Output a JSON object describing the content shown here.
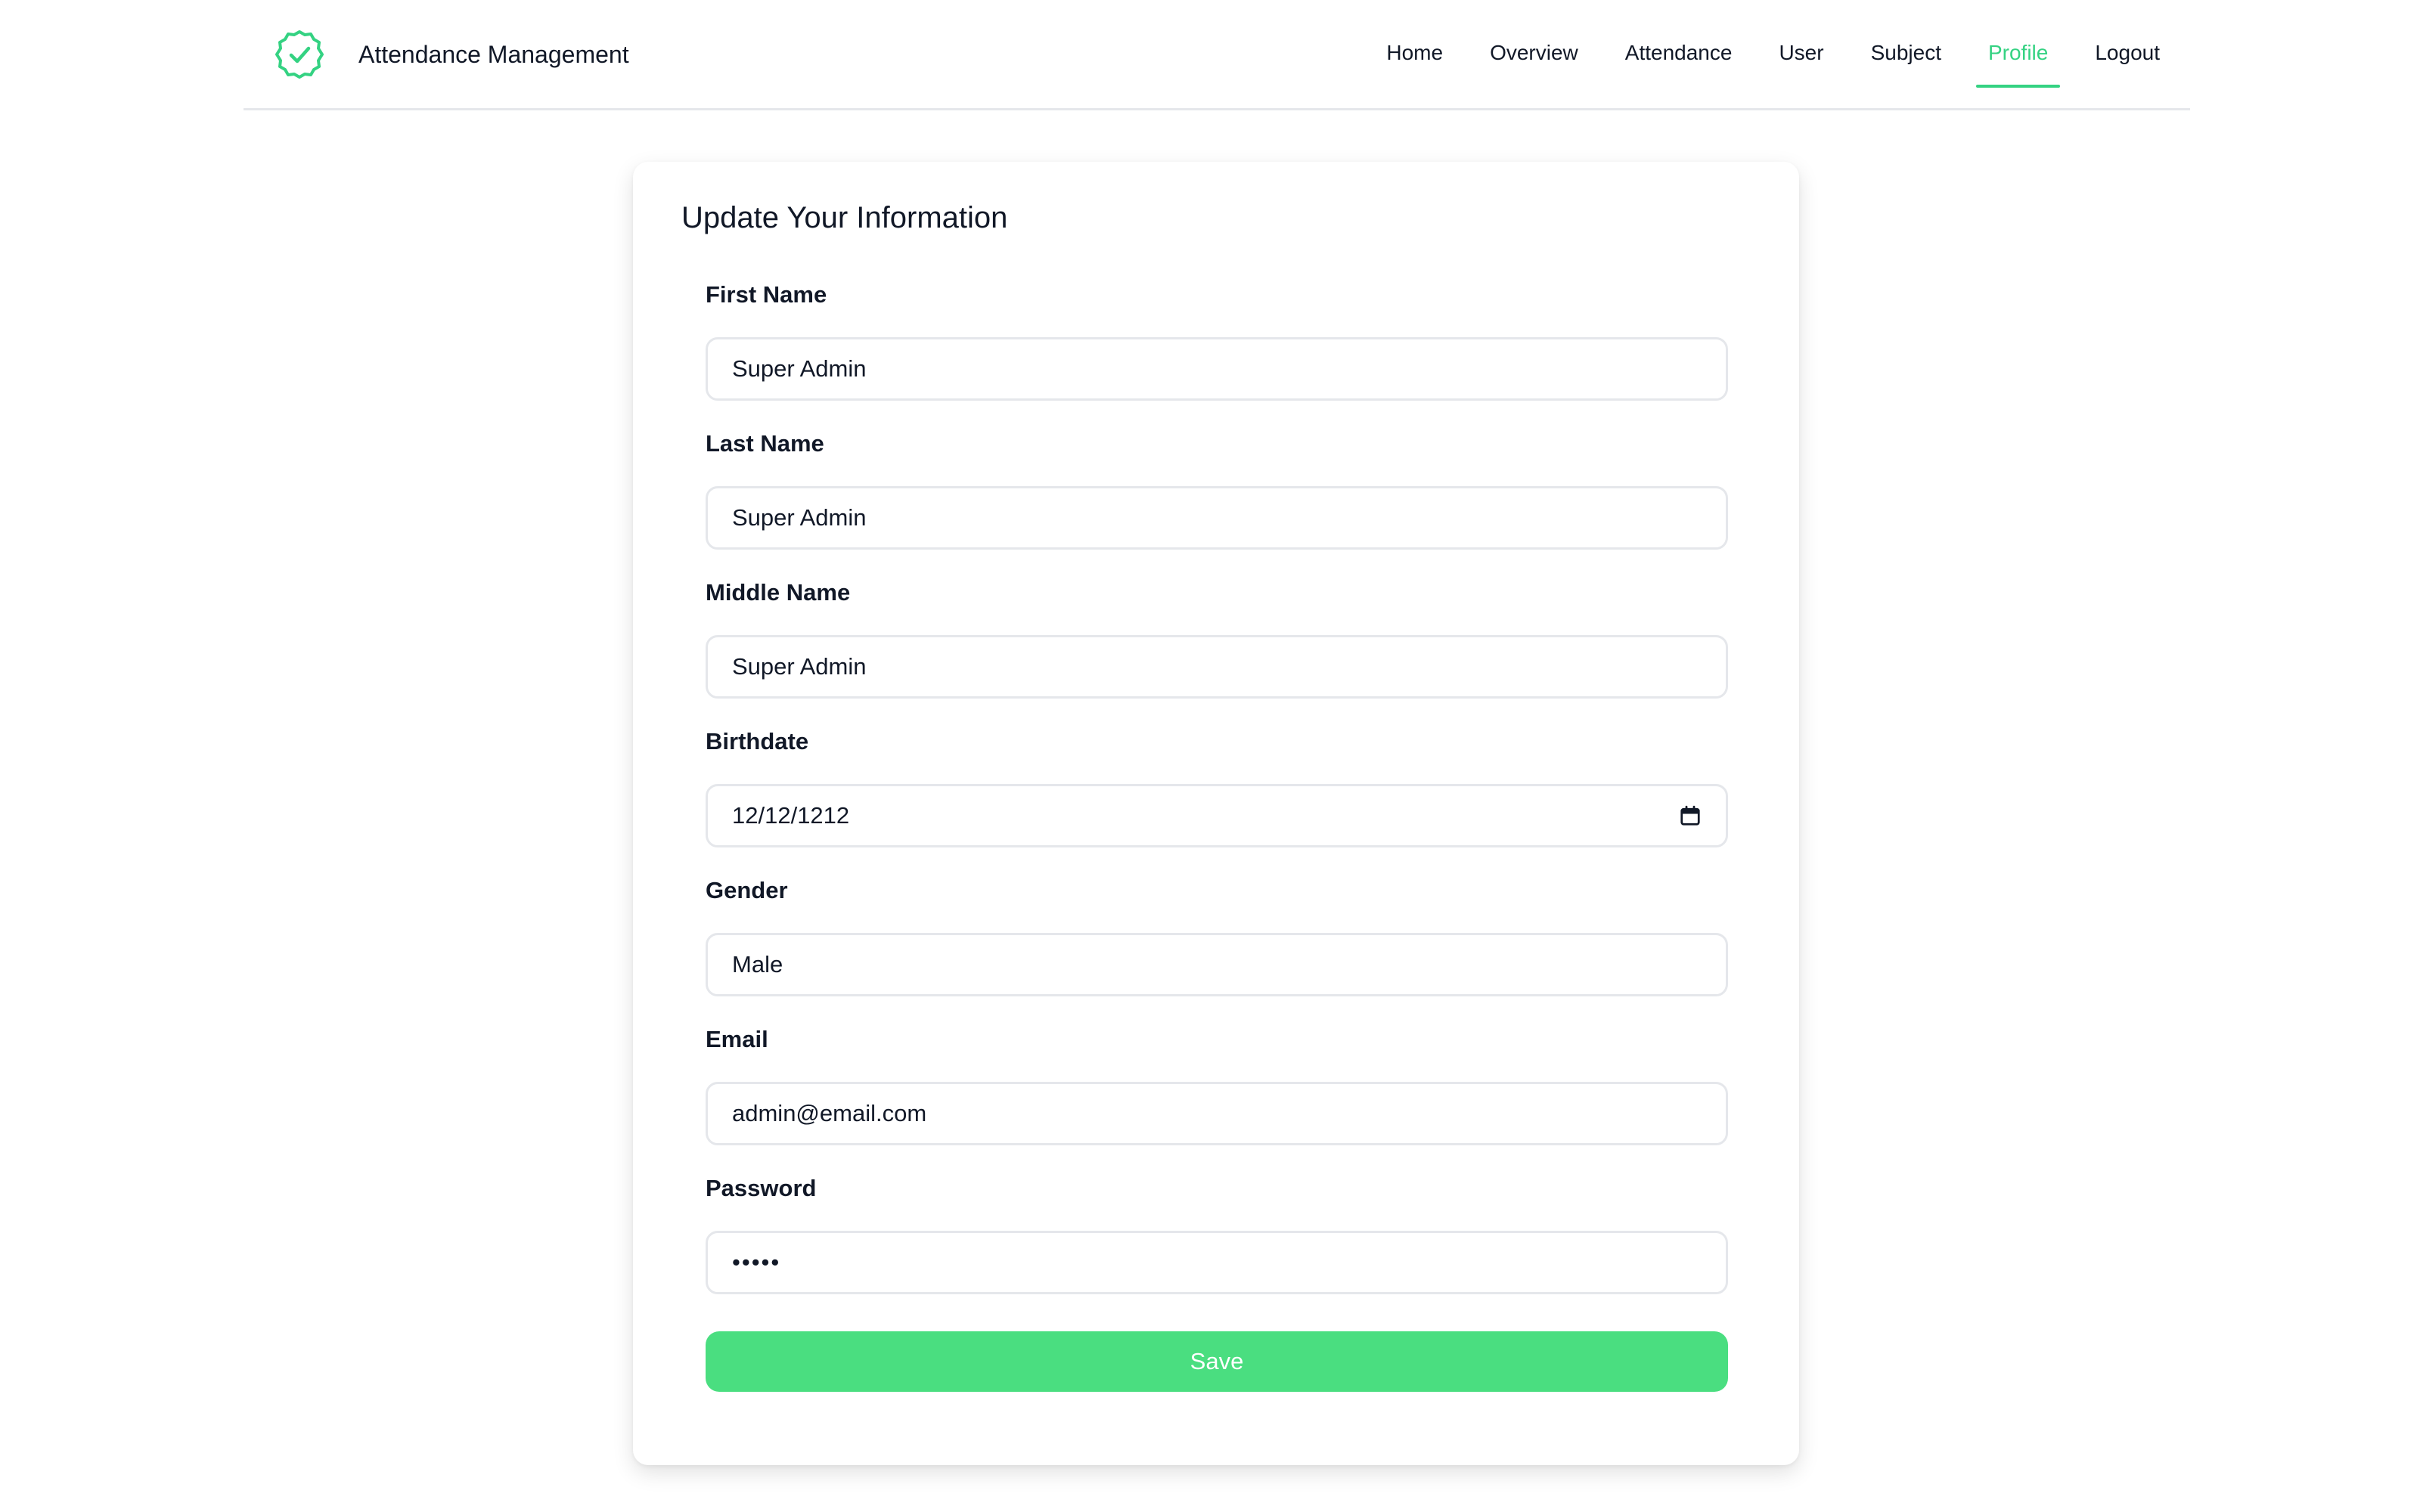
{
  "app": {
    "title": "Attendance Management",
    "accent_color": "#34d282",
    "logo_icon": "check-badge-icon"
  },
  "nav": {
    "items": [
      {
        "label": "Home",
        "active": false
      },
      {
        "label": "Overview",
        "active": false
      },
      {
        "label": "Attendance",
        "active": false
      },
      {
        "label": "User",
        "active": false
      },
      {
        "label": "Subject",
        "active": false
      },
      {
        "label": "Profile",
        "active": true
      },
      {
        "label": "Logout",
        "active": false
      }
    ]
  },
  "form": {
    "title": "Update Your Information",
    "fields": [
      {
        "label": "First Name",
        "value": "Super Admin",
        "type": "text"
      },
      {
        "label": "Last Name",
        "value": "Super Admin",
        "type": "text"
      },
      {
        "label": "Middle Name",
        "value": "Super Admin",
        "type": "text"
      },
      {
        "label": "Birthdate",
        "value": "12/12/1212",
        "type": "date",
        "icon": "calendar-icon"
      },
      {
        "label": "Gender",
        "value": "Male",
        "type": "text"
      },
      {
        "label": "Email",
        "value": "admin@email.com",
        "type": "email"
      },
      {
        "label": "Password",
        "value": "•••••",
        "type": "password"
      }
    ],
    "save_label": "Save",
    "save_color": "#4ade80"
  }
}
